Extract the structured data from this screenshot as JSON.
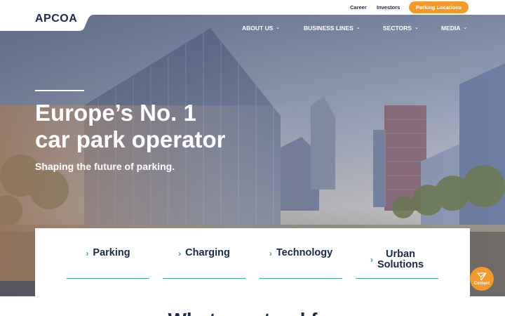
{
  "brand": {
    "logo_text": "APCOA"
  },
  "topbar": {
    "career_label": "Career",
    "investors_label": "Investors",
    "parking_locations_label": "Parking Locations"
  },
  "nav": {
    "items": [
      {
        "label": "ABOUT US"
      },
      {
        "label": "BUSINESS LINES"
      },
      {
        "label": "SECTORS"
      },
      {
        "label": "MEDIA"
      }
    ]
  },
  "hero": {
    "title_line1": "Europe’s No. 1",
    "title_line2": "car park operator",
    "subtitle": "Shaping the future of parking."
  },
  "services": {
    "items": [
      {
        "label": "Parking"
      },
      {
        "label": "Charging"
      },
      {
        "label": "Technology"
      },
      {
        "label_line1": "Urban",
        "label_line2": "Solutions"
      }
    ]
  },
  "contact": {
    "label": "Contact"
  },
  "section": {
    "heading": "What we stand for"
  },
  "colors": {
    "navy": "#1b2a4a",
    "accent_orange": "#f39a2b",
    "accent_teal": "#2fa7a0"
  },
  "icons": {
    "nav_chevron": "chevron-down-icon",
    "service_arrow": "chevron-right-icon",
    "contact": "paper-plane-icon"
  }
}
